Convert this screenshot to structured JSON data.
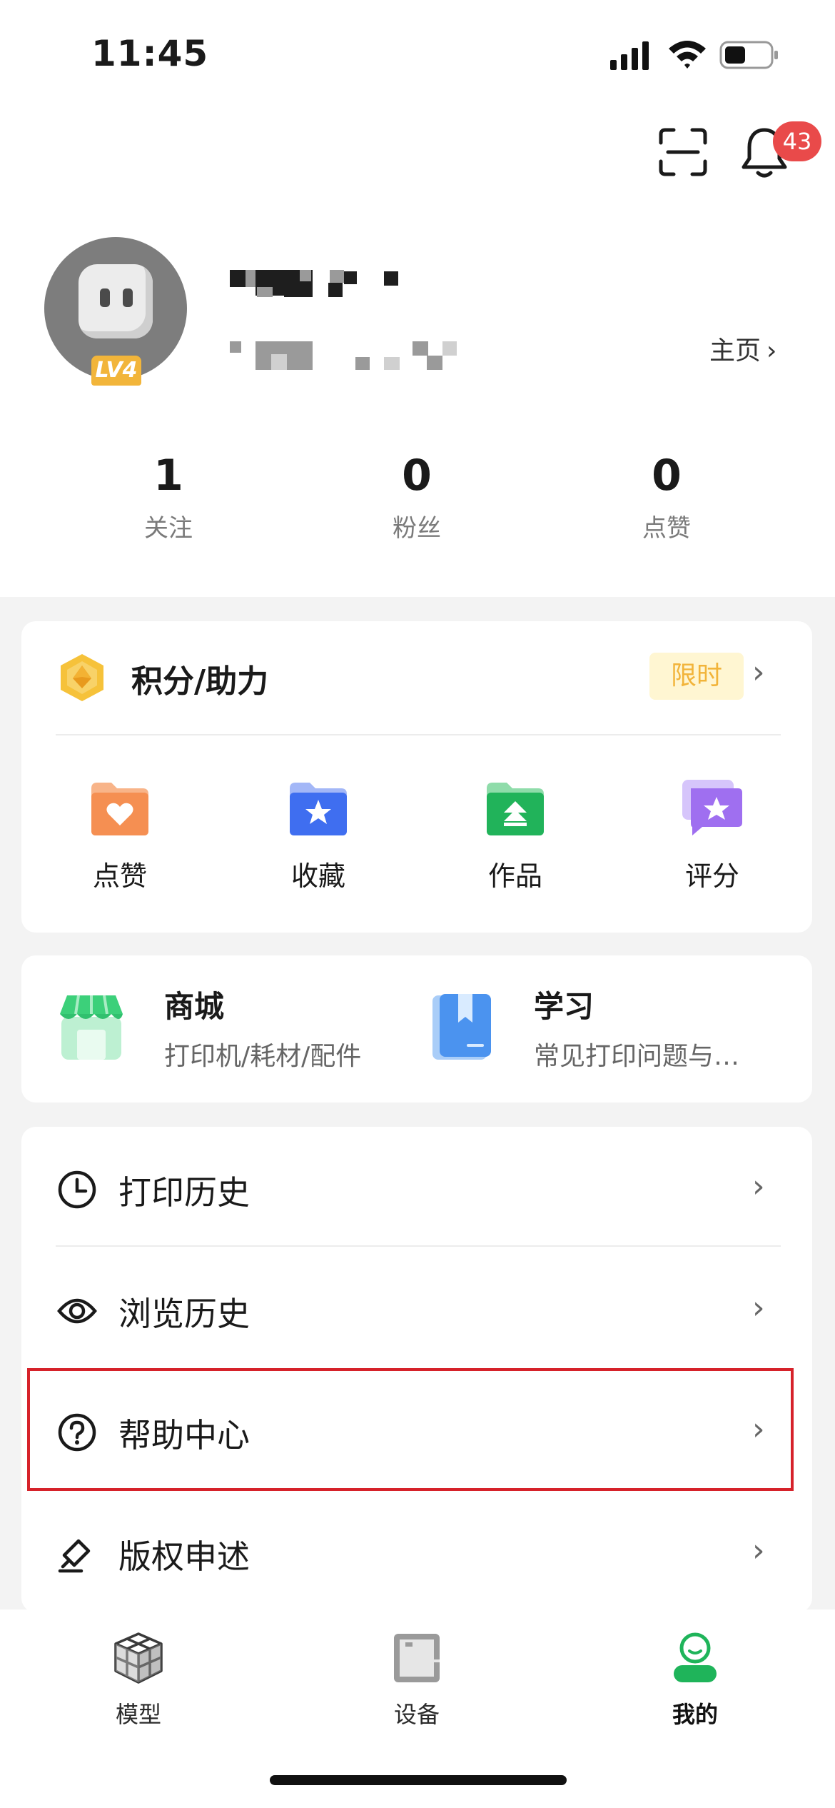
{
  "status_bar": {
    "time": "11:45"
  },
  "header": {
    "notification_count": "43"
  },
  "profile": {
    "level_badge": "LV4",
    "homepage_link": "主页",
    "stats": [
      {
        "value": "1",
        "label": "关注"
      },
      {
        "value": "0",
        "label": "粉丝"
      },
      {
        "value": "0",
        "label": "点赞"
      }
    ]
  },
  "points_card": {
    "title": "积分/助力",
    "tag": "限时",
    "actions": [
      {
        "label": "点赞",
        "icon": "heart-folder-icon"
      },
      {
        "label": "收藏",
        "icon": "star-folder-icon"
      },
      {
        "label": "作品",
        "icon": "upload-folder-icon"
      },
      {
        "label": "评分",
        "icon": "rating-bubble-icon"
      }
    ]
  },
  "shortcuts": [
    {
      "title": "商城",
      "subtitle": "打印机/耗材/配件",
      "icon": "store-icon"
    },
    {
      "title": "学习",
      "subtitle": "常见打印问题与…",
      "icon": "book-icon"
    }
  ],
  "menu": [
    {
      "label": "打印历史",
      "icon": "clock-icon"
    },
    {
      "label": "浏览历史",
      "icon": "eye-icon"
    },
    {
      "label": "帮助中心",
      "icon": "question-circle-icon"
    },
    {
      "label": "版权申述",
      "icon": "gavel-icon"
    }
  ],
  "tabbar": [
    {
      "label": "模型",
      "icon": "cubes-icon"
    },
    {
      "label": "设备",
      "icon": "printer-device-icon"
    },
    {
      "label": "我的",
      "icon": "user-profile-icon"
    }
  ],
  "colors": {
    "brand_green": "#1fb45a",
    "badge_red": "#e94a4a",
    "limited_tag_bg": "#fff6d2",
    "limited_tag_text": "#f2b43a",
    "highlight_border": "#d6222a"
  }
}
